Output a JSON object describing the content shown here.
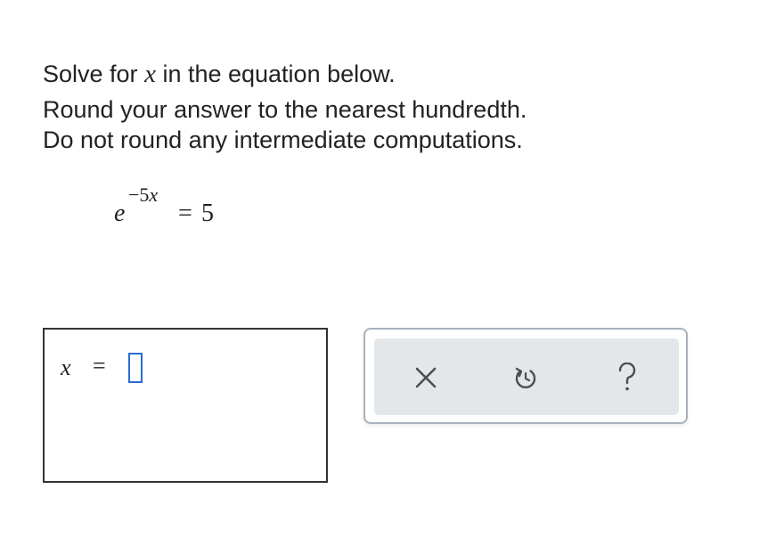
{
  "instructions": {
    "line1_prefix": "Solve for ",
    "line1_var": "x",
    "line1_suffix": " in the equation below.",
    "line2": "Round your answer to the nearest hundredth.",
    "line3": "Do not round any intermediate computations."
  },
  "equation": {
    "base": "e",
    "exponent_sign": "−",
    "exponent_coef": "5",
    "exponent_var": "x",
    "equals": "=",
    "rhs": "5"
  },
  "answer": {
    "variable": "x",
    "equals": "=",
    "value": ""
  },
  "toolbar": {
    "clear_icon": "close-icon",
    "undo_icon": "undo-icon",
    "help_icon": "help-icon",
    "icon_color": "#4a4f55",
    "input_border_color": "#2a6bd6"
  }
}
